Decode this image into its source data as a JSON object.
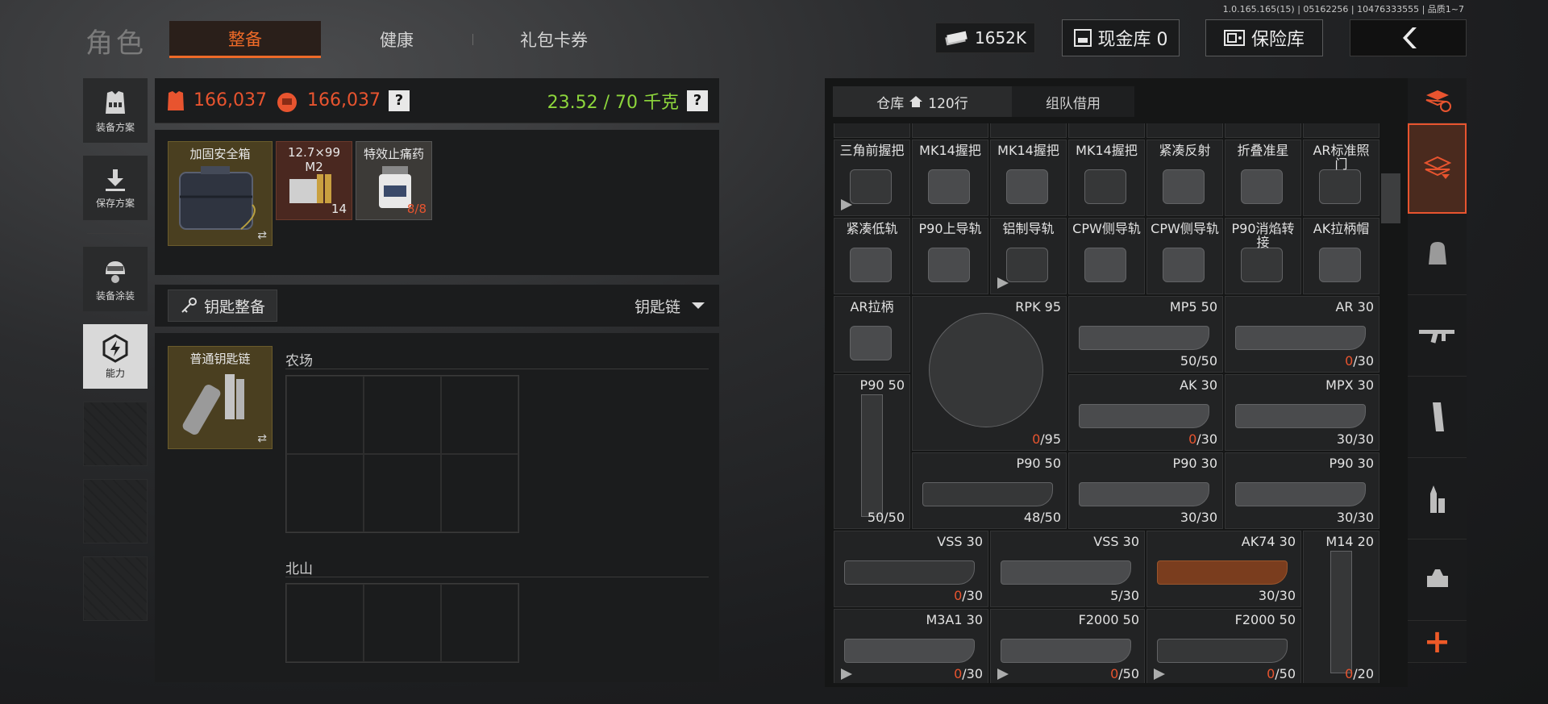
{
  "version": "1.0.165.165(15) | 05162256 | 10476333555 | 品质1~7",
  "header": {
    "title": "角色",
    "tabs": [
      "整备",
      "健康",
      "礼包卡券"
    ],
    "money": "1652K",
    "cash_button": "现金库 0",
    "safe_button": "保险库"
  },
  "left_menu": [
    {
      "label": "装备方案",
      "icon": "vest-icon"
    },
    {
      "label": "保存方案",
      "icon": "download-icon"
    },
    {
      "label": "装备涂装",
      "icon": "helmet-icon"
    },
    {
      "label": "能力",
      "icon": "ability-icon"
    }
  ],
  "stats": {
    "armor_value": "166,037",
    "bag_value": "166,037",
    "help": "?",
    "weight": "23.52 / 70 千克"
  },
  "containers": [
    {
      "name": "加固安全箱",
      "qty": "⇄"
    },
    {
      "name": "12.7×99 M2",
      "qty": "14"
    },
    {
      "name": "特效止痛药",
      "qty": "8/8"
    }
  ],
  "keys": {
    "button": "钥匙整备",
    "dropdown": "钥匙链",
    "key_item": "普通钥匙链",
    "regions": [
      "农场",
      "北山"
    ]
  },
  "storage": {
    "tab_warehouse": "仓库",
    "rows": "120行",
    "tab_team": "组队借用"
  },
  "inventory": [
    {
      "label": "三角前握把",
      "count": "",
      "marked": true
    },
    {
      "label": "MK14握把",
      "count": ""
    },
    {
      "label": "MK14握把",
      "count": ""
    },
    {
      "label": "MK14握把",
      "count": ""
    },
    {
      "label": "紧凑反射",
      "count": ""
    },
    {
      "label": "折叠准星",
      "count": ""
    },
    {
      "label": "AR标准照门",
      "count": ""
    },
    {
      "label": "紧凑低轨",
      "count": ""
    },
    {
      "label": "P90上导轨",
      "count": ""
    },
    {
      "label": "铝制导轨",
      "count": "",
      "marked": true
    },
    {
      "label": "CPW侧导轨",
      "count": ""
    },
    {
      "label": "CPW侧导轨",
      "count": ""
    },
    {
      "label": "P90消焰转接",
      "count": ""
    },
    {
      "label": "AK拉柄帽",
      "count": ""
    },
    {
      "label": "AR拉柄",
      "count": ""
    },
    {
      "label": "RPK 95",
      "count_red": "0",
      "count": "/95"
    },
    {
      "label": "MP5 50",
      "count": "50/50"
    },
    {
      "label": "AR 30",
      "count_red": "0",
      "count": "/30"
    },
    {
      "label": "P90 50",
      "count": "50/50"
    },
    {
      "label": "AK 30",
      "count_red": "0",
      "count": "/30"
    },
    {
      "label": "MPX 30",
      "count": "30/30"
    },
    {
      "label": "P90 50",
      "count": "48/50"
    },
    {
      "label": "P90 30",
      "count": "30/30"
    },
    {
      "label": "P90 30",
      "count": "30/30"
    },
    {
      "label": "VSS 30",
      "count_red": "0",
      "count": "/30"
    },
    {
      "label": "VSS 30",
      "count": "5/30"
    },
    {
      "label": "AK74 30",
      "count": "30/30"
    },
    {
      "label": "M14 20",
      "count_red": "0",
      "count": "/20"
    },
    {
      "label": "M3A1 30",
      "count_red": "0",
      "count": "/30",
      "marked": true
    },
    {
      "label": "F2000 50",
      "count_red": "0",
      "count": "/50",
      "marked": true
    },
    {
      "label": "F2000 50",
      "count_red": "0",
      "count": "/50",
      "marked": true
    }
  ],
  "right_side": [
    "refresh-icon",
    "layers-icon",
    "backpack-icon",
    "rifle-icon",
    "magazine-icon",
    "ammo-icon",
    "scope-icon",
    "add-icon"
  ],
  "colors": {
    "accent": "#ee6a28",
    "weight": "#8dd63c",
    "red": "#e8542f"
  }
}
